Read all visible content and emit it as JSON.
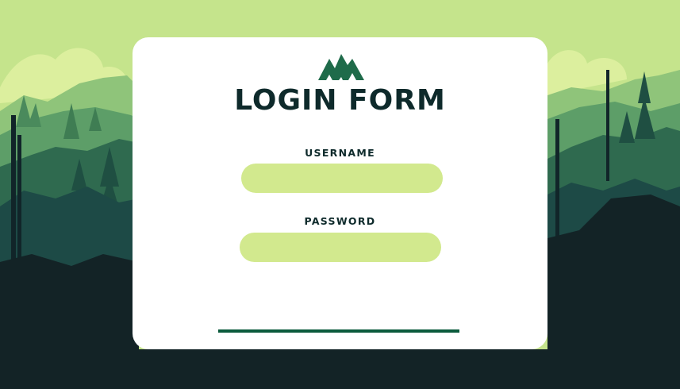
{
  "form": {
    "title": "LOGIN FORM",
    "username_label": "USERNAME",
    "username_value": "",
    "password_label": "PASSWORD",
    "password_value": ""
  },
  "icons": {
    "logo": "mountain-logo-icon"
  },
  "colors": {
    "sky": "#c5e48c",
    "card": "#ffffff",
    "title_text": "#0e2a2b",
    "input_fill": "#d2e98e",
    "accent_line": "#0b5a3c",
    "logo": "#1f6b4a"
  }
}
